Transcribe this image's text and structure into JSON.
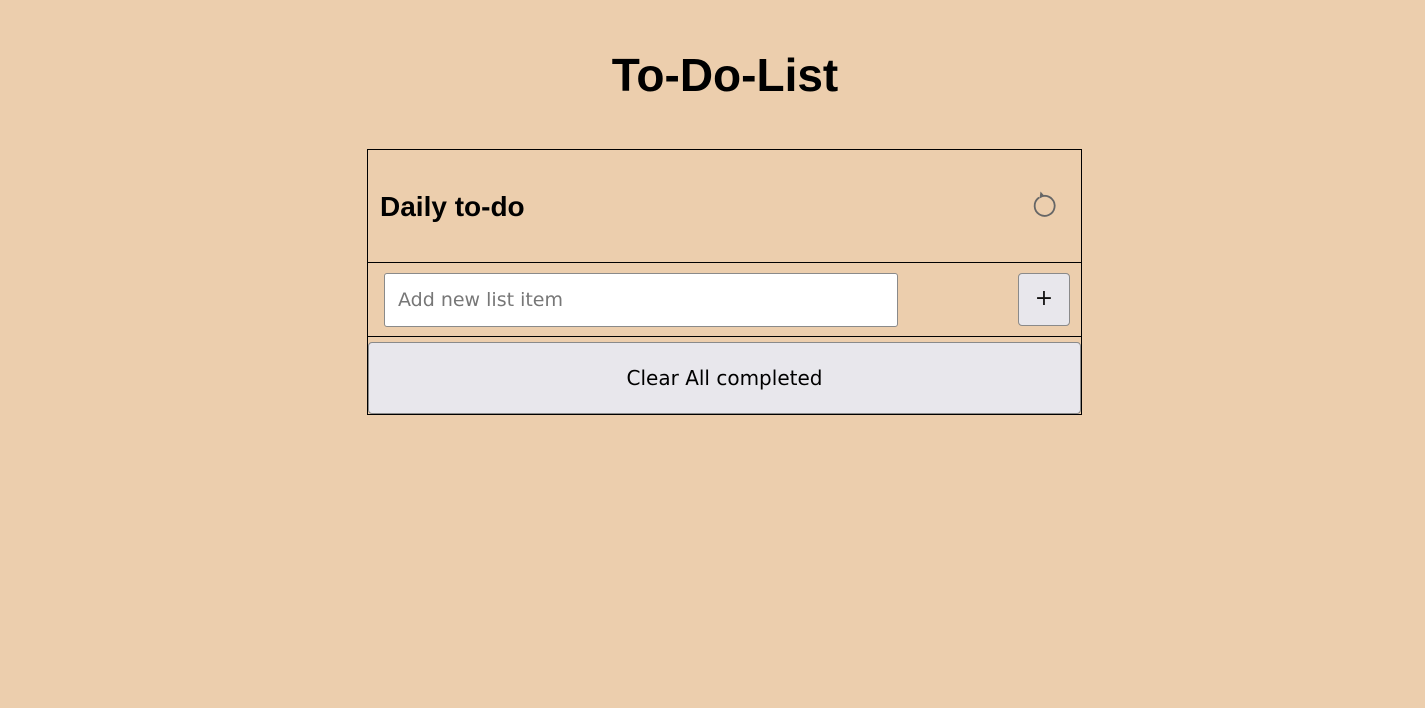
{
  "page": {
    "title": "To-Do-List",
    "background_color": "#ECCEAD"
  },
  "list": {
    "title": "Daily to-do",
    "reset_icon": "refresh-ccw-icon",
    "input": {
      "placeholder": "Add new list item",
      "value": ""
    },
    "add_button_label": "+",
    "clear_button_label": "Clear All completed",
    "button_color": "#E8E7EC"
  }
}
